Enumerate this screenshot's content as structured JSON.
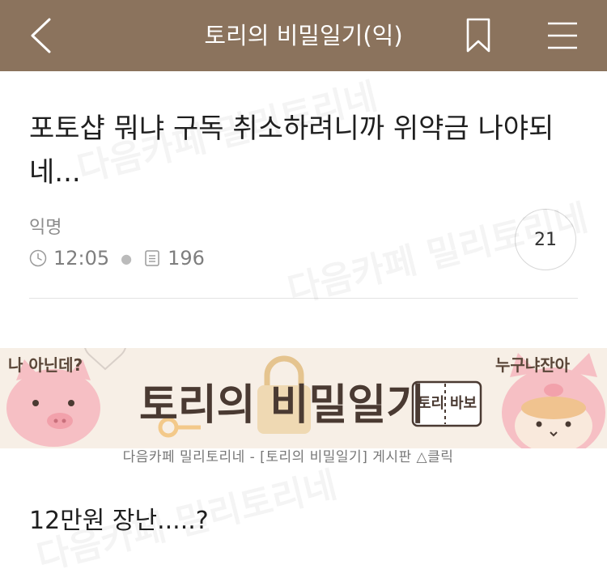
{
  "header": {
    "title": "토리의 비밀일기(익)",
    "background_color": "#8b735d"
  },
  "post": {
    "title": "포토샵 뭐냐 구독 취소하려니까 위약금 나야되네...",
    "author": "익명",
    "time": "12:05",
    "views": "196",
    "comment_count": "21",
    "body": "12만원 장난.....?"
  },
  "banner": {
    "title": "토리의 비밀일기",
    "left_caption": "나 아닌데?",
    "right_caption": "누구냐잔아",
    "sign_text_1": "토리",
    "sign_text_2": "바보",
    "subtext": "다음카페 밀리토리네 - [토리의 비밀일기] 게시판 △클릭"
  },
  "watermark": {
    "text": "다음카페 밀리토리네"
  }
}
